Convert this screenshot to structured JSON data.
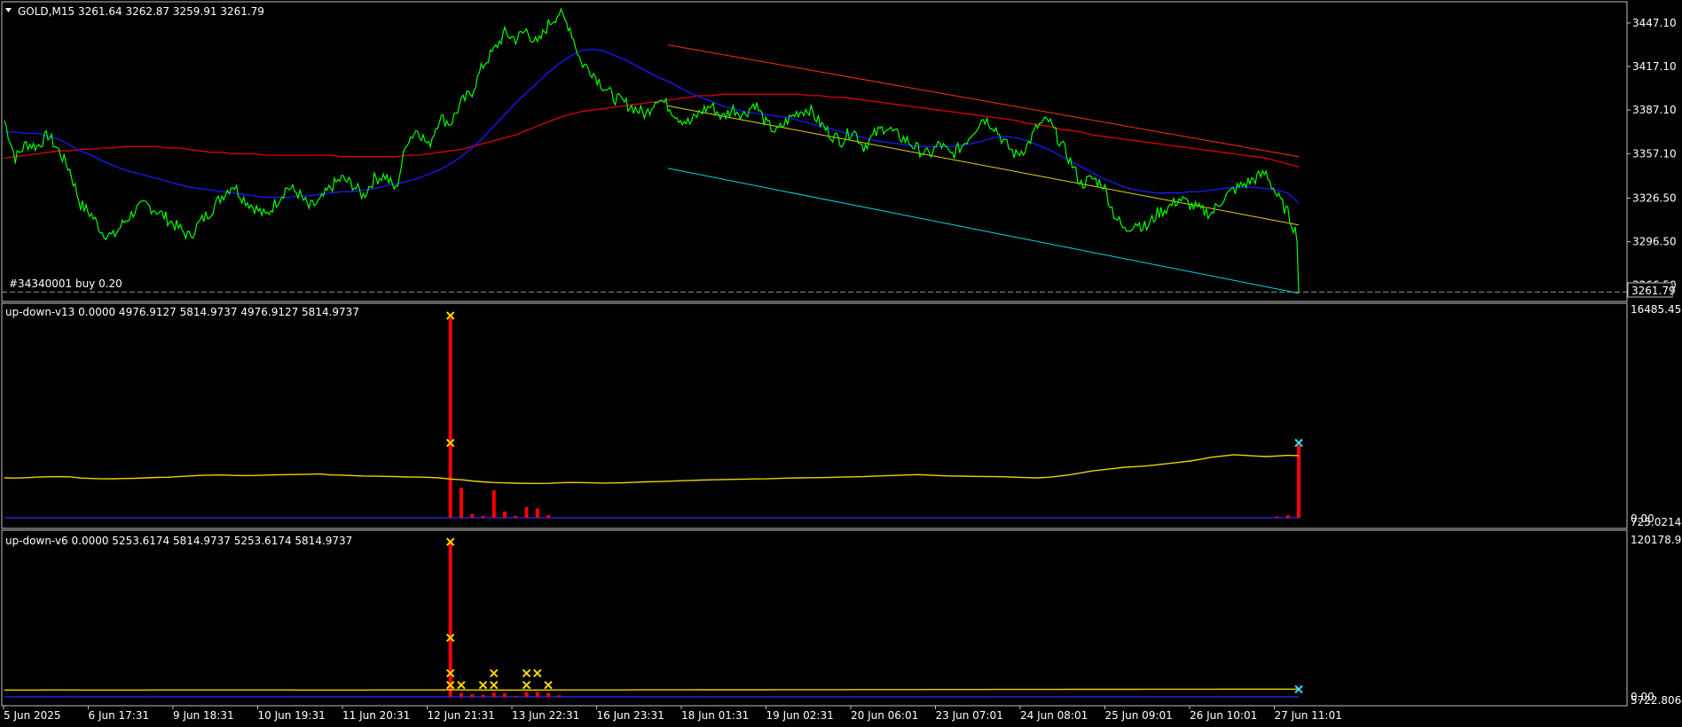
{
  "header": {
    "title": "GOLD,M15",
    "ohlc": "3261.64 3262.87 3259.91 3261.79"
  },
  "trade_label": "#34340001 buy 0.20",
  "current_price_label": "3261.79",
  "colors": {
    "background": "#000000",
    "price": "#00ff00",
    "ma_blue": "#1a1aff",
    "ma_red": "#e00000",
    "channel_upper": "#ff3300",
    "channel_mid": "#e6d21a",
    "channel_lower": "#00d8e8",
    "indicator_line": "#f0d000",
    "indicator_hist": "#ff0000",
    "marker": "#ffd700",
    "marker_last": "#35e0ff"
  },
  "chart_data": [
    {
      "type": "line",
      "name_label": "GOLD,M15",
      "price_ticks": [
        "3447.10",
        "3417.10",
        "3387.10",
        "3357.10",
        "3326.50",
        "3296.50",
        "3266.50"
      ],
      "price_tick_values": [
        3447.1,
        3417.1,
        3387.1,
        3357.1,
        3326.5,
        3296.5,
        3266.5
      ],
      "ylim": [
        3259,
        3458
      ],
      "x_count": 120,
      "price": [
        3380,
        3354,
        3364,
        3362,
        3370,
        3359,
        3346,
        3322,
        3315,
        3303,
        3300,
        3310,
        3318,
        3322,
        3318,
        3312,
        3306,
        3300,
        3310,
        3318,
        3328,
        3336,
        3326,
        3320,
        3314,
        3324,
        3334,
        3330,
        3320,
        3324,
        3334,
        3340,
        3336,
        3328,
        3340,
        3342,
        3332,
        3366,
        3374,
        3362,
        3382,
        3378,
        3392,
        3400,
        3418,
        3428,
        3440,
        3436,
        3442,
        3432,
        3446,
        3454,
        3444,
        3420,
        3414,
        3404,
        3396,
        3392,
        3388,
        3384,
        3396,
        3390,
        3382,
        3378,
        3386,
        3390,
        3382,
        3388,
        3384,
        3392,
        3378,
        3372,
        3380,
        3386,
        3388,
        3378,
        3370,
        3366,
        3374,
        3362,
        3370,
        3376,
        3370,
        3366,
        3360,
        3356,
        3364,
        3356,
        3362,
        3372,
        3382,
        3376,
        3364,
        3356,
        3362,
        3376,
        3380,
        3366,
        3352,
        3336,
        3340,
        3336,
        3316,
        3304,
        3310,
        3306,
        3316,
        3320,
        3326,
        3322,
        3318,
        3316,
        3326,
        3332,
        3336,
        3340,
        3344,
        3328,
        3316,
        3298
      ],
      "ma_blue": [
        3372,
        3372,
        3371,
        3371,
        3369,
        3367,
        3363,
        3359,
        3356,
        3352,
        3349,
        3346,
        3344,
        3342,
        3340,
        3338,
        3336,
        3334,
        3333,
        3332,
        3331,
        3330,
        3329,
        3328,
        3327,
        3327,
        3327,
        3328,
        3328,
        3329,
        3330,
        3331,
        3331,
        3332,
        3333,
        3335,
        3336,
        3338,
        3340,
        3343,
        3346,
        3350,
        3355,
        3361,
        3368,
        3376,
        3384,
        3392,
        3399,
        3406,
        3413,
        3419,
        3424,
        3428,
        3429,
        3428,
        3425,
        3422,
        3418,
        3414,
        3410,
        3407,
        3403,
        3399,
        3396,
        3393,
        3390,
        3388,
        3386,
        3385,
        3384,
        3383,
        3382,
        3380,
        3378,
        3376,
        3374,
        3372,
        3370,
        3368,
        3366,
        3365,
        3364,
        3363,
        3362,
        3362,
        3362,
        3362,
        3363,
        3364,
        3366,
        3368,
        3369,
        3368,
        3366,
        3363,
        3360,
        3356,
        3352,
        3348,
        3344,
        3340,
        3337,
        3334,
        3332,
        3331,
        3330,
        3330,
        3330,
        3331,
        3331,
        3332,
        3333,
        3334,
        3334,
        3334,
        3333,
        3332,
        3330,
        3323
      ],
      "ma_red": [
        3354,
        3355,
        3356,
        3357,
        3358,
        3359,
        3359,
        3360,
        3360,
        3361,
        3361,
        3362,
        3362,
        3362,
        3362,
        3361,
        3361,
        3360,
        3359,
        3358,
        3358,
        3357,
        3357,
        3357,
        3356,
        3356,
        3356,
        3356,
        3356,
        3356,
        3356,
        3355,
        3355,
        3355,
        3355,
        3355,
        3355,
        3356,
        3356,
        3357,
        3358,
        3359,
        3360,
        3362,
        3364,
        3366,
        3368,
        3370,
        3373,
        3376,
        3379,
        3382,
        3384,
        3386,
        3387,
        3388,
        3389,
        3390,
        3391,
        3392,
        3393,
        3394,
        3395,
        3396,
        3397,
        3397,
        3398,
        3398,
        3398,
        3398,
        3398,
        3398,
        3398,
        3398,
        3397,
        3397,
        3396,
        3396,
        3395,
        3394,
        3393,
        3392,
        3391,
        3390,
        3389,
        3388,
        3387,
        3386,
        3385,
        3384,
        3383,
        3382,
        3381,
        3380,
        3378,
        3377,
        3376,
        3374,
        3373,
        3372,
        3370,
        3369,
        3368,
        3367,
        3366,
        3365,
        3364,
        3363,
        3362,
        3361,
        3360,
        3359,
        3358,
        3357,
        3356,
        3355,
        3354,
        3352,
        3350,
        3348
      ],
      "channel": {
        "x_range": [
          61,
          120
        ],
        "upper": [
          3432,
          3355
        ],
        "mid": [
          3390,
          3308
        ],
        "lower": [
          3347,
          3261
        ]
      },
      "current_price": 3261.79
    },
    {
      "type": "bar",
      "indicator": "up-down-v13",
      "label": "up-down-v13 0.0000 4976.9127 5814.9737 4976.9127 5814.9737",
      "ticks": [
        "16485.450",
        "0.00",
        "725.0214"
      ],
      "ylim": [
        0,
        16485.45
      ],
      "x_count": 120,
      "line_values": [
        3200,
        3180,
        3210,
        3260,
        3280,
        3300,
        3280,
        3180,
        3150,
        3120,
        3130,
        3150,
        3160,
        3200,
        3230,
        3250,
        3300,
        3350,
        3400,
        3420,
        3430,
        3400,
        3380,
        3390,
        3420,
        3440,
        3460,
        3470,
        3490,
        3510,
        3430,
        3420,
        3380,
        3350,
        3330,
        3320,
        3300,
        3270,
        3260,
        3240,
        3200,
        3100,
        3050,
        2950,
        2880,
        2820,
        2800,
        2770,
        2760,
        2750,
        2760,
        2800,
        2830,
        2820,
        2800,
        2780,
        2790,
        2810,
        2850,
        2880,
        2900,
        2930,
        2960,
        2990,
        3020,
        3040,
        3060,
        3080,
        3100,
        3110,
        3120,
        3150,
        3180,
        3200,
        3210,
        3220,
        3240,
        3260,
        3280,
        3300,
        3330,
        3370,
        3400,
        3430,
        3460,
        3420,
        3380,
        3350,
        3340,
        3320,
        3310,
        3300,
        3280,
        3250,
        3220,
        3200,
        3250,
        3350,
        3450,
        3600,
        3750,
        3850,
        3950,
        4050,
        4100,
        4150,
        4250,
        4350,
        4450,
        4550,
        4700,
        4850,
        4950,
        5050,
        5000,
        4950,
        4900,
        4950,
        5000,
        4976.9
      ],
      "hist_values": [
        0,
        0,
        0,
        0,
        0,
        0,
        0,
        0,
        0,
        0,
        0,
        0,
        0,
        0,
        0,
        0,
        0,
        0,
        0,
        0,
        0,
        0,
        0,
        0,
        0,
        0,
        0,
        0,
        0,
        0,
        0,
        0,
        0,
        0,
        0,
        0,
        0,
        0,
        0,
        0,
        0,
        16000,
        2400,
        300,
        150,
        2200,
        500,
        150,
        850,
        750,
        200,
        0,
        0,
        0,
        0,
        0,
        0,
        0,
        0,
        0,
        0,
        0,
        0,
        0,
        0,
        0,
        0,
        0,
        0,
        0,
        0,
        0,
        0,
        0,
        0,
        0,
        0,
        0,
        0,
        0,
        0,
        0,
        0,
        0,
        0,
        0,
        0,
        0,
        0,
        0,
        0,
        0,
        0,
        0,
        0,
        0,
        0,
        0,
        0,
        0,
        0,
        0,
        0,
        0,
        0,
        0,
        0,
        0,
        0,
        0,
        0,
        0,
        0,
        0,
        0,
        0,
        0,
        100,
        200,
        5800
      ],
      "markers": [
        {
          "i": 41,
          "v": 16200
        },
        {
          "i": 41,
          "v": 6000
        }
      ],
      "last_marker": {
        "i": 119,
        "v": 6000
      }
    },
    {
      "type": "bar",
      "indicator": "up-down-v6",
      "label": "up-down-v6 0.0000 5253.6174 5814.9737 5253.6174 5814.9737",
      "ticks": [
        "120178.93",
        "0.00",
        "5722.8064"
      ],
      "ylim": [
        0,
        120178.93
      ],
      "x_count": 120,
      "line_values": [
        5200,
        5210,
        5220,
        5230,
        5240,
        5250,
        5240,
        5230,
        5220,
        5210,
        5200,
        5210,
        5220,
        5230,
        5240,
        5250,
        5260,
        5270,
        5280,
        5290,
        5300,
        5290,
        5280,
        5270,
        5260,
        5250,
        5240,
        5230,
        5220,
        5210,
        5200,
        5210,
        5220,
        5230,
        5240,
        5250,
        5260,
        5270,
        5280,
        5290,
        5300,
        5400,
        5300,
        5250,
        5230,
        5220,
        5210,
        5200,
        5210,
        5220,
        5230,
        5240,
        5250,
        5260,
        5270,
        5280,
        5290,
        5300,
        5310,
        5320,
        5330,
        5340,
        5350,
        5360,
        5370,
        5380,
        5390,
        5400,
        5410,
        5420,
        5430,
        5440,
        5450,
        5460,
        5470,
        5480,
        5490,
        5500,
        5510,
        5520,
        5530,
        5540,
        5550,
        5560,
        5570,
        5580,
        5590,
        5600,
        5610,
        5620,
        5630,
        5640,
        5650,
        5660,
        5670,
        5680,
        5690,
        5700,
        5710,
        5720,
        5730,
        5740,
        5750,
        5760,
        5770,
        5780,
        5790,
        5800,
        5810,
        5820,
        5830,
        5840,
        5850,
        5860,
        5870,
        5880,
        5890,
        5880,
        5870,
        5814.9
      ],
      "hist_values": [
        0,
        0,
        0,
        0,
        0,
        0,
        0,
        0,
        0,
        0,
        0,
        0,
        0,
        0,
        0,
        0,
        0,
        0,
        0,
        0,
        0,
        0,
        0,
        0,
        0,
        0,
        0,
        0,
        0,
        0,
        0,
        0,
        0,
        0,
        0,
        0,
        0,
        0,
        0,
        0,
        0,
        118000,
        3000,
        2000,
        1500,
        3200,
        2800,
        800,
        3500,
        3800,
        3000,
        1200,
        0,
        0,
        0,
        0,
        0,
        0,
        0,
        0,
        0,
        0,
        0,
        0,
        0,
        0,
        0,
        0,
        0,
        0,
        0,
        0,
        0,
        0,
        0,
        0,
        0,
        0,
        0,
        0,
        0,
        0,
        0,
        0,
        0,
        0,
        0,
        0,
        0,
        0,
        0,
        0,
        0,
        0,
        0,
        0,
        0,
        0,
        0,
        0,
        0,
        0,
        0,
        0,
        0,
        0,
        0,
        0,
        0,
        0,
        0,
        0,
        0,
        0,
        0,
        0,
        0,
        0,
        0,
        0
      ],
      "markers": [
        {
          "i": 41,
          "v": 118000
        },
        {
          "i": 41,
          "v": 45000
        },
        {
          "i": 41,
          "v": 18000
        },
        {
          "i": 41,
          "v": 9000
        },
        {
          "i": 42,
          "v": 9000
        },
        {
          "i": 44,
          "v": 9000
        },
        {
          "i": 45,
          "v": 18000
        },
        {
          "i": 45,
          "v": 9000
        },
        {
          "i": 48,
          "v": 18000
        },
        {
          "i": 48,
          "v": 9000
        },
        {
          "i": 49,
          "v": 18000
        },
        {
          "i": 50,
          "v": 9000
        }
      ],
      "last_marker": {
        "i": 119,
        "v": 5800
      }
    }
  ],
  "time_axis": [
    "5 Jun 2025",
    "6 Jun 17:31",
    "9 Jun 18:31",
    "10 Jun 19:31",
    "11 Jun 20:31",
    "12 Jun 21:31",
    "13 Jun 22:31",
    "16 Jun 23:31",
    "18 Jun 01:31",
    "19 Jun 02:31",
    "20 Jun 06:01",
    "23 Jun 07:01",
    "24 Jun 08:01",
    "25 Jun 09:01",
    "26 Jun 10:01",
    "27 Jun 11:01"
  ]
}
